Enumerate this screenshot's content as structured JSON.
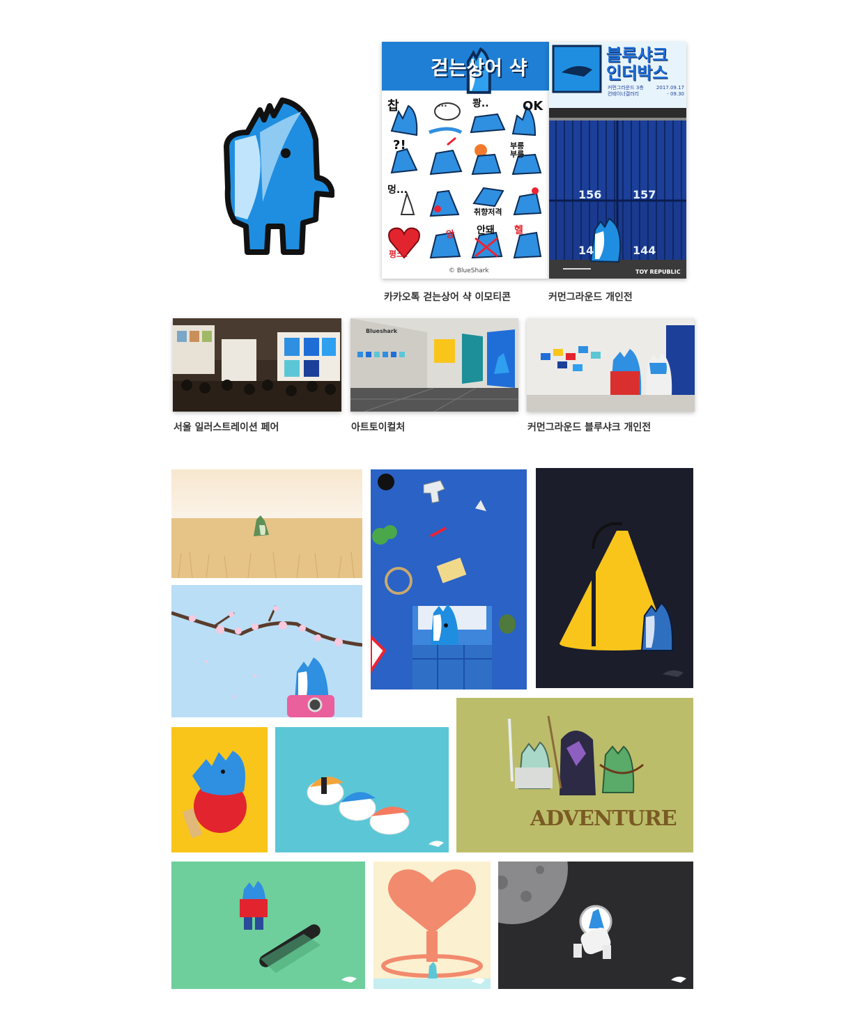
{
  "colors": {
    "brand_blue": "#1f8ee0",
    "dark_blue": "#1c4fa8",
    "outline": "#111111",
    "yellow": "#f9c51b",
    "navy_bg": "#1b1d2b",
    "sky": "#b8def6",
    "teal": "#5bc7d6",
    "olive": "#bcbd6a",
    "green": "#6ecf9c"
  },
  "top": {
    "mascot_icon": "shark-mascot",
    "emoticon_sheet": {
      "header": "걷는상어 샥",
      "stickers": [
        "찹",
        "...",
        "쾅..",
        "OK",
        "?!",
        "",
        "",
        "부릉부릉",
        "멍...",
        "",
        "취향저격",
        "",
        "",
        "앙",
        "안돼",
        "헬"
      ],
      "heart_text": "평크!",
      "footer": "© BlueShark"
    },
    "exhibition_poster": {
      "title_line1": "블루샤크",
      "title_line2": "인더박스",
      "sub_line1": "커먼그라운드 3층",
      "sub_line2": "컨테이너갤러리",
      "date_start": "2017.09.17",
      "date_end": "- 09.30",
      "container_left": "156",
      "container_right": "157",
      "container_bottom_left": "14",
      "container_bottom_right": "144",
      "brand": "TOY REPUBLIC"
    },
    "captions": {
      "emoticon": "카카오톡 걷는상어 샥 이모티콘",
      "exhibition": "커먼그라운드 개인전"
    }
  },
  "photos": [
    {
      "caption": "서울 일러스트레이션 페어"
    },
    {
      "caption": "아트토이컬처",
      "brand": "Blueshark"
    },
    {
      "caption": "커먼그라운드 블루샤크 개인전"
    }
  ],
  "illustrations": {
    "adventure_title": "ADVENTURE"
  }
}
